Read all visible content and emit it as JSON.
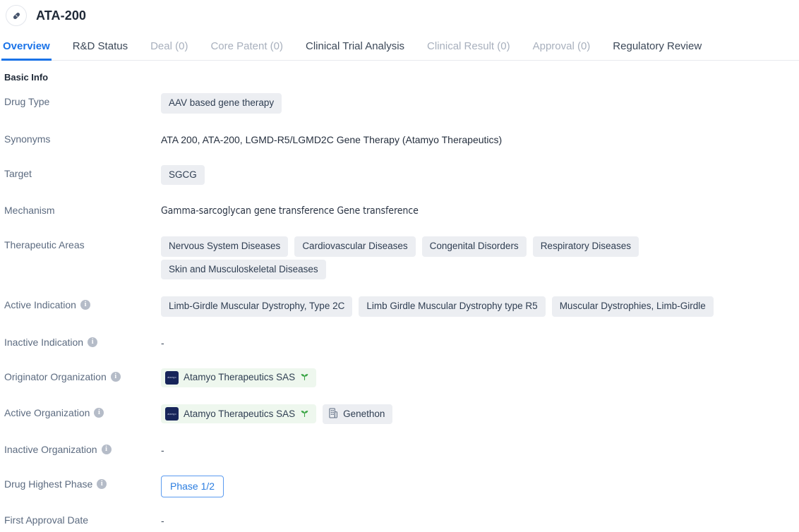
{
  "header": {
    "icon": "pill-capsule-icon",
    "title": "ATA-200"
  },
  "tabs": [
    {
      "label": "Overview",
      "state": "active"
    },
    {
      "label": "R&D Status",
      "state": "normal"
    },
    {
      "label": "Deal (0)",
      "state": "disabled"
    },
    {
      "label": "Core Patent (0)",
      "state": "disabled"
    },
    {
      "label": "Clinical Trial Analysis",
      "state": "normal"
    },
    {
      "label": "Clinical Result (0)",
      "state": "disabled"
    },
    {
      "label": "Approval (0)",
      "state": "disabled"
    },
    {
      "label": "Regulatory Review",
      "state": "normal"
    }
  ],
  "section": {
    "title": "Basic Info"
  },
  "rows": {
    "drug_type": {
      "label": "Drug Type",
      "chips": [
        "AAV based gene therapy"
      ]
    },
    "synonyms": {
      "label": "Synonyms",
      "text": "ATA 200,  ATA-200,  LGMD-R5/LGMD2C Gene Therapy (Atamyo Therapeutics)"
    },
    "target": {
      "label": "Target",
      "chips": [
        "SGCG"
      ]
    },
    "mechanism": {
      "label": "Mechanism",
      "text": "Gamma-sarcoglycan gene transference  Gene transference"
    },
    "therapeutic_areas": {
      "label": "Therapeutic Areas",
      "chips": [
        "Nervous System Diseases",
        "Cardiovascular Diseases",
        "Congenital Disorders",
        "Respiratory Diseases",
        "Skin and Musculoskeletal Diseases"
      ]
    },
    "active_indication": {
      "label": "Active Indication",
      "has_info": true,
      "chips": [
        "Limb-Girdle Muscular Dystrophy, Type 2C",
        "Limb Girdle Muscular Dystrophy type R5",
        "Muscular Dystrophies, Limb-Girdle"
      ]
    },
    "inactive_indication": {
      "label": "Inactive Indication",
      "has_info": true,
      "value": "-"
    },
    "originator_organization": {
      "label": "Originator Organization",
      "has_info": true,
      "orgs": [
        {
          "name": "Atamyo Therapeutics SAS",
          "logo_text": "atamyo",
          "style": "green",
          "badge": "sprout-icon"
        }
      ]
    },
    "active_organization": {
      "label": "Active Organization",
      "has_info": true,
      "orgs": [
        {
          "name": "Atamyo Therapeutics SAS",
          "logo_text": "atamyo",
          "style": "green",
          "badge": "sprout-icon"
        },
        {
          "name": "Genethon",
          "style": "grey",
          "icon": "company-building-icon"
        }
      ]
    },
    "inactive_organization": {
      "label": "Inactive Organization",
      "has_info": true,
      "value": "-"
    },
    "drug_highest_phase": {
      "label": "Drug Highest Phase",
      "has_info": true,
      "badge": "Phase 1/2"
    },
    "first_approval_date": {
      "label": "First Approval Date",
      "value": "-"
    }
  },
  "colors": {
    "accent_blue": "#1a73e8",
    "chip_grey": "#eceef2",
    "chip_green": "#eef7ee",
    "label_grey": "#5c6b80",
    "logo_navy": "#17255a",
    "sprout_green": "#3aa545"
  }
}
